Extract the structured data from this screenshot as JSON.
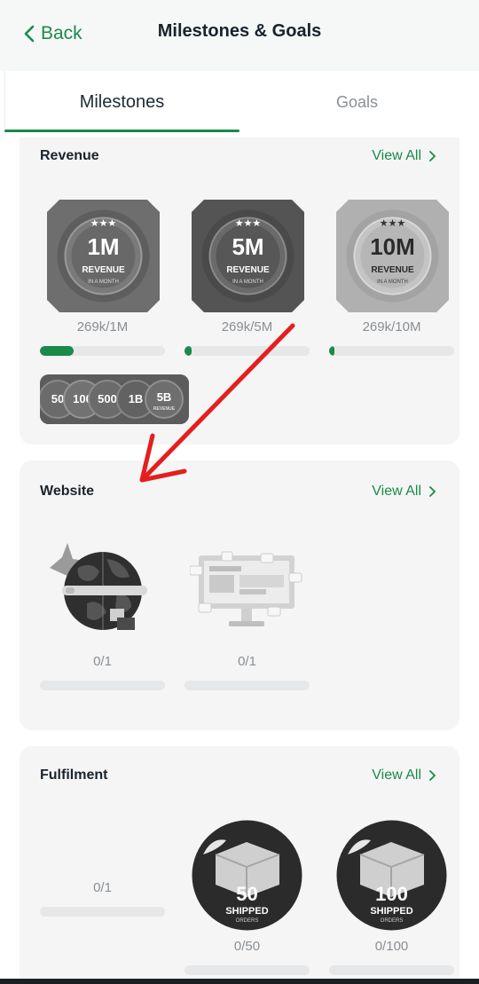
{
  "header": {
    "back_label": "Back",
    "title": "Milestones & Goals"
  },
  "tabs": [
    {
      "label": "Milestones",
      "active": true
    },
    {
      "label": "Goals",
      "active": false
    }
  ],
  "accent_color": "#1a8a4a",
  "sections": {
    "revenue": {
      "title": "Revenue",
      "view_all": "View All",
      "badges": [
        {
          "big": "1M",
          "sub": "REVENUE",
          "tiny": "IN A MONTH",
          "progress_text": "269k/1M",
          "progress": 0.269
        },
        {
          "big": "5M",
          "sub": "REVENUE",
          "tiny": "IN A MONTH",
          "progress_text": "269k/5M",
          "progress": 0.054
        },
        {
          "big": "10M",
          "sub": "REVENUE",
          "tiny": "IN A MONTH",
          "progress_text": "269k/10M",
          "progress": 0.027
        }
      ],
      "strip_badges": [
        "50",
        "100",
        "500",
        "1B",
        "5B"
      ],
      "strip_last_sub": "REVENUE"
    },
    "website": {
      "title": "Website",
      "view_all": "View All",
      "items": [
        {
          "icon": "globe-launch-icon",
          "progress_text": "0/1",
          "progress": 0
        },
        {
          "icon": "website-builder-icon",
          "progress_text": "0/1",
          "progress": 0
        }
      ]
    },
    "fulfilment": {
      "title": "Fulfilment",
      "view_all": "View All",
      "items": [
        {
          "progress_text": "0/1",
          "progress": 0
        },
        {
          "big": "50",
          "sub": "SHIPPED",
          "tiny": "ORDERS",
          "progress_text": "0/50",
          "progress": 0
        },
        {
          "big": "100",
          "sub": "SHIPPED",
          "tiny": "ORDERS",
          "progress_text": "0/100",
          "progress": 0
        }
      ]
    }
  }
}
